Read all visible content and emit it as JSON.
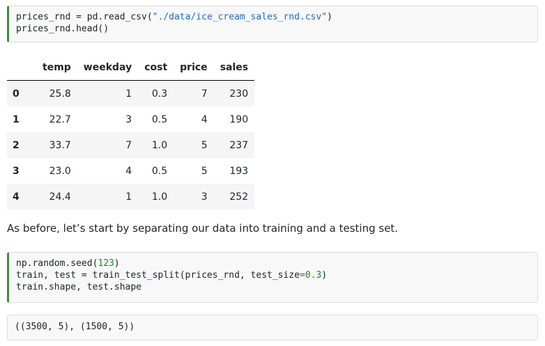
{
  "code_cell_1": {
    "lines": [
      [
        "prices_rnd = pd.read_csv(",
        "\"./data/ice_cream_sales_rnd.csv\"",
        ")"
      ],
      [
        "prices_rnd.head()"
      ]
    ]
  },
  "dataframe": {
    "columns": [
      "temp",
      "weekday",
      "cost",
      "price",
      "sales"
    ],
    "rows": [
      {
        "index": "0",
        "values": [
          "25.8",
          "1",
          "0.3",
          "7",
          "230"
        ]
      },
      {
        "index": "1",
        "values": [
          "22.7",
          "3",
          "0.5",
          "4",
          "190"
        ]
      },
      {
        "index": "2",
        "values": [
          "33.7",
          "7",
          "1.0",
          "5",
          "237"
        ]
      },
      {
        "index": "3",
        "values": [
          "23.0",
          "4",
          "0.5",
          "5",
          "193"
        ]
      },
      {
        "index": "4",
        "values": [
          "24.4",
          "1",
          "1.0",
          "3",
          "252"
        ]
      }
    ]
  },
  "prose": "As before, let’s start by separating our data into training and a testing set.",
  "code_cell_2": {
    "line1_a": "np.random.seed(",
    "line1_num": "123",
    "line1_b": ")",
    "line2_a": "train, test = train_test_split(prices_rnd, test_size",
    "line2_eq": "=",
    "line2_num": "0.3",
    "line2_b": ")",
    "line3": "train.shape, test.shape"
  },
  "output_cell": {
    "text": "((3500, 5), (1500, 5))"
  },
  "colors": {
    "cell_border_accent": "#3d8b3d",
    "string": "#1a6dbf",
    "number": "#20882a"
  }
}
